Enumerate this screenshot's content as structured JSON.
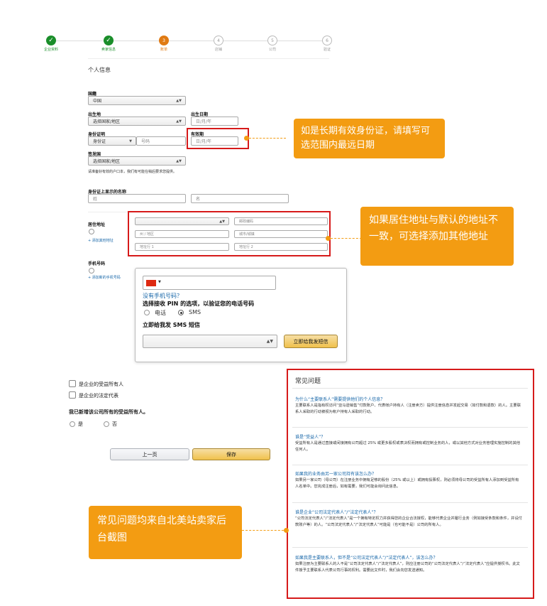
{
  "stepper": {
    "steps": [
      {
        "label": "企业资料",
        "state": "done",
        "num": "✓"
      },
      {
        "label": "卖家信息",
        "state": "done",
        "num": "✓"
      },
      {
        "label": "账单",
        "state": "active",
        "num": "3"
      },
      {
        "label": "店铺",
        "state": "todo",
        "num": "4"
      },
      {
        "label": "公司",
        "state": "todo",
        "num": "5"
      },
      {
        "label": "验证",
        "state": "todo",
        "num": "6"
      }
    ]
  },
  "section_title": "个人信息",
  "nationality": {
    "label": "国籍",
    "value": "中国"
  },
  "birthplace": {
    "label": "出生地",
    "value": "选择国家/地区"
  },
  "birthdate": {
    "label": "出生日期",
    "placeholder": "日/月/年"
  },
  "id_doc": {
    "label": "身份证明",
    "type_value": "身份证",
    "number_placeholder": "号码"
  },
  "expiry": {
    "label": "有效期",
    "placeholder": "日/月/年"
  },
  "issuing_country": {
    "label": "签发国",
    "value": "选择国家/地区",
    "note": "请准备好有效的户口本，我们有可能在稍后要求您提供。"
  },
  "name_on_id": {
    "label": "身份证上显示的名称",
    "first_placeholder": "姓",
    "last_placeholder": "名"
  },
  "address": {
    "label": "居住地址",
    "add_link": "+ 添加其他地址",
    "postal_placeholder": "邮政编码",
    "state_placeholder": "州 / 地区",
    "city_placeholder": "城市/城镇",
    "line1_placeholder": "地址行 1",
    "line2_placeholder": "地址行 2"
  },
  "phone": {
    "label": "手机号码",
    "add_link": "+ 添加新的手机号码",
    "no_phone_link": "没有手机号码？",
    "pin_title": "选择接收 PIN 的选项，以验证您的电话号码",
    "opt_call": "电话",
    "opt_sms": "SMS",
    "sms_title": "立即给我发 SMS 短信",
    "send_button": "立即给我发短信"
  },
  "checks": {
    "beneficial_owner": "是企业的受益所有人",
    "legal_rep": "是企业的法定代表",
    "question": "我已新增该公司所有的受益所有人。",
    "yes": "是",
    "no": "否"
  },
  "nav": {
    "prev": "上一页",
    "save": "保存"
  },
  "faq": {
    "title": "常见问题",
    "items": [
      {
        "q": "为什么“主要联系人”需要提供他们的个人信息？",
        "a": "主要联系人是指有权访问“亚马逊销售”付款账户、代表帐户持有人（注册卖方）提供注册信息并发起交易（如付款和退款）的人。主要联系人采取的行动被视为帐户持有人采取的行动。"
      },
      {
        "q": "谁是“受益人”？",
        "a": "受益所有人是通过直接或间接拥有公司超过 25% 或更多股权或表决权而拥有或控制业务的人，或以其他方式对业务管理实施控制的其他任何人。"
      },
      {
        "q": "如果我的业务由另一家公司持有该怎么办？",
        "a": "如果另一家公司（母公司）在注册业务中拥有足够的股份（25% 或以上）或拥有投票权，则必须将母公司的受益所有人添加到受益所有人名单中。您完成注册后，如有需要，我们可能会询问此信息。"
      },
      {
        "q": "谁是企业“公司法定代表人”/“法定代表人”？",
        "a": "“公司法定代表人”/“法定代表人”是一个拥有特定权力并获得您的企业合法授权，能够代表企业并履行业务（例如接受条款和条件，并设付款账户等）的人。“公司法定代表人”/“法定代表人”可能是（也可能不是）公司的所有人。"
      },
      {
        "q": "如果我是主要联系人，但不是“公司法定代表人”/“法定代表人”，该怎么办？",
        "a": "如果注册为主要联系人的人不是“公司法定代表人”/“法定代表人”，则应注册公司的“公司法定代表人”/“法定代表人”应提供授权书。此文件授予主要联系人代表公司行事的权利。需要此文件时，我们会向您发送通知。"
      }
    ]
  },
  "callouts": {
    "expiry_note": "如是长期有效身份证，请填写可选范围内最远日期",
    "address_note": "如果居住地址与默认的地址不一致，可选择添加其他地址",
    "faq_note": "常见问题均来自北美站卖家后台截图"
  },
  "colors": {
    "accent": "#f39c12",
    "red": "#d61a1a",
    "green": "#1a8e2a",
    "link": "#1666a8",
    "save_btn": "#f3c95a"
  }
}
